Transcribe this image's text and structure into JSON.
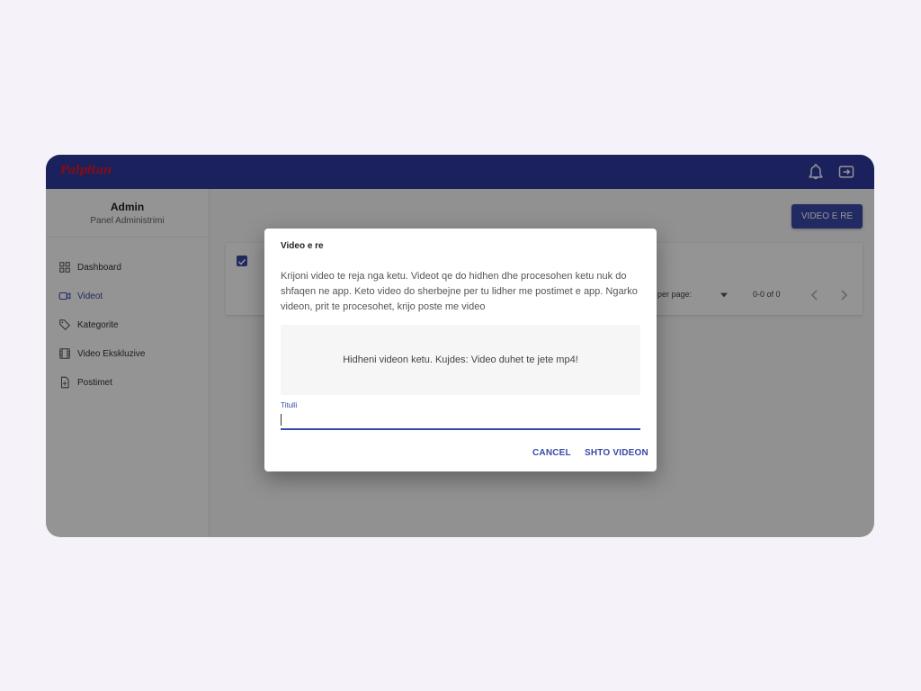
{
  "app": {
    "logo_text": "Palpitan",
    "colors": {
      "primary": "#3949ab",
      "appbar": "#2f3a9f",
      "logo": "#e0162a"
    },
    "topbar_icons": [
      "bell-icon",
      "exit-icon"
    ]
  },
  "sidebar": {
    "title": "Admin",
    "subtitle": "Panel Administrimi",
    "items": [
      {
        "label": "Dashboard",
        "icon": "grid-icon"
      },
      {
        "label": "Videot",
        "icon": "video-icon",
        "active": true
      },
      {
        "label": "Kategorite",
        "icon": "tag-icon"
      },
      {
        "label": "Video Ekskluzive",
        "icon": "film-icon"
      },
      {
        "label": "Postimet",
        "icon": "document-icon"
      }
    ]
  },
  "main": {
    "new_video_button": "VIDEO E RE",
    "table": {
      "select_all_checked": true,
      "rows_per_page_label": "per page:",
      "pagination_text": "0-0 of 0"
    }
  },
  "dialog": {
    "title": "Video e re",
    "description": "Krijoni video te reja nga ketu. Videot qe do hidhen dhe procesohen ketu nuk do shfaqen ne app. Keto video do sherbejne per tu lidher me postimet e app. Ngarko videon, prit te procesohet, krijo poste me video",
    "dropzone_text": "Hidheni videon ketu. Kujdes: Video duhet te jete mp4!",
    "title_field_label": "Titulli",
    "title_field_value": "",
    "cancel_button": "CANCEL",
    "submit_button": "SHTO VIDEON"
  }
}
